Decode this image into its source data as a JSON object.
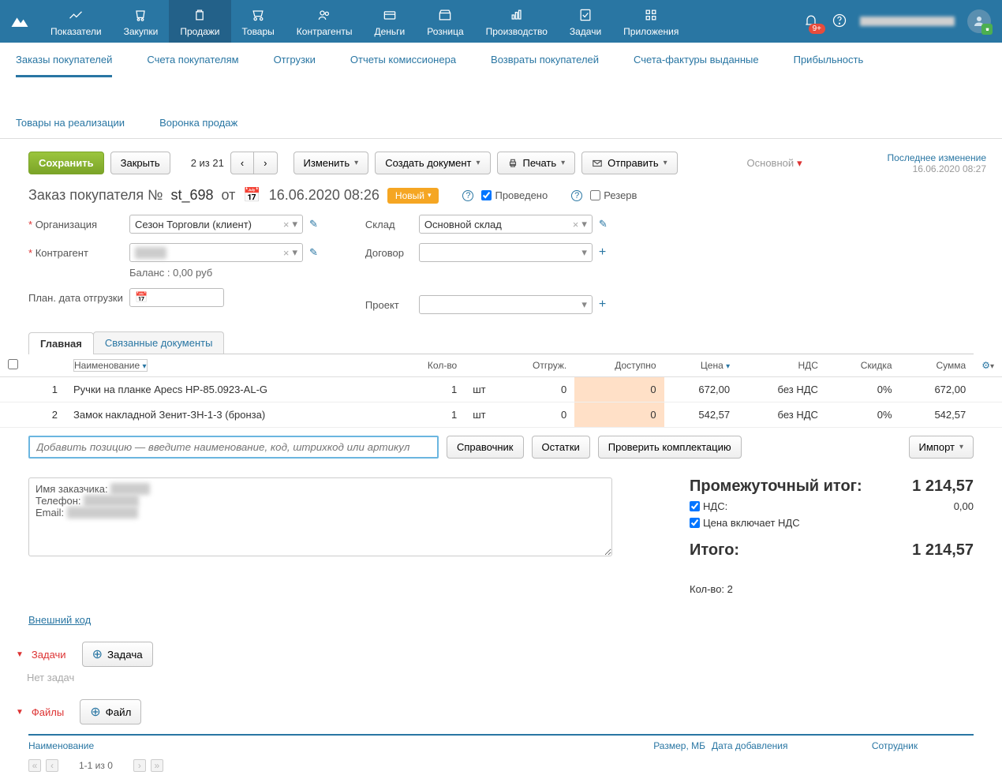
{
  "topnav": {
    "items": [
      {
        "label": "Показатели"
      },
      {
        "label": "Закупки"
      },
      {
        "label": "Продажи"
      },
      {
        "label": "Товары"
      },
      {
        "label": "Контрагенты"
      },
      {
        "label": "Деньги"
      },
      {
        "label": "Розница"
      },
      {
        "label": "Производство"
      },
      {
        "label": "Задачи"
      },
      {
        "label": "Приложения"
      }
    ],
    "notif_badge": "9+"
  },
  "subnav": {
    "items": [
      "Заказы покупателей",
      "Счета покупателям",
      "Отгрузки",
      "Отчеты комиссионера",
      "Возвраты покупателей",
      "Счета-фактуры выданные",
      "Прибыльность",
      "Товары на реализации",
      "Воронка продаж"
    ]
  },
  "toolbar": {
    "save": "Сохранить",
    "close": "Закрыть",
    "pager_text": "2 из 21",
    "edit": "Изменить",
    "create_doc": "Создать документ",
    "print": "Печать",
    "send": "Отправить",
    "type": "Основной",
    "last_change_label": "Последнее изменение",
    "last_change_time": "16.06.2020 08:27"
  },
  "doc": {
    "title_prefix": "Заказ покупателя №",
    "number": "st_698",
    "from": "от",
    "date": "16.06.2020 08:26",
    "status": "Новый",
    "posted_label": "Проведено",
    "reserve_label": "Резерв"
  },
  "form": {
    "org_label": "Организация",
    "org_value": "Сезон Торговли (клиент)",
    "counterparty_label": "Контрагент",
    "counterparty_value": "████",
    "balance": "Баланс : 0,00 руб",
    "plan_date_label": "План. дата отгрузки",
    "warehouse_label": "Склад",
    "warehouse_value": "Основной склад",
    "contract_label": "Договор",
    "project_label": "Проект"
  },
  "tabs": {
    "main": "Главная",
    "related": "Связанные документы"
  },
  "grid": {
    "name_hdr": "Наименование",
    "qty_hdr": "Кол-во",
    "shipped_hdr": "Отгруж.",
    "avail_hdr": "Доступно",
    "price_hdr": "Цена",
    "vat_hdr": "НДС",
    "discount_hdr": "Скидка",
    "sum_hdr": "Сумма",
    "rows": [
      {
        "n": "1",
        "name": "Ручки на планке Apecs HP-85.0923-AL-G",
        "qty": "1",
        "unit": "шт",
        "shipped": "0",
        "avail": "0",
        "price": "672,00",
        "vat": "без НДС",
        "disc": "0%",
        "sum": "672,00"
      },
      {
        "n": "2",
        "name": "Замок накладной Зенит-ЗН-1-3 (бронза)",
        "qty": "1",
        "unit": "шт",
        "shipped": "0",
        "avail": "0",
        "price": "542,57",
        "vat": "без НДС",
        "disc": "0%",
        "sum": "542,57"
      }
    ],
    "add_placeholder": "Добавить позицию — введите наименование, код, штрихкод или артикул",
    "reference": "Справочник",
    "stock": "Остатки",
    "check_kit": "Проверить комплектацию",
    "import": "Импорт"
  },
  "notes": {
    "line1": "Имя заказчика: ",
    "line2": "Телефон: ",
    "line3": "Email: "
  },
  "totals": {
    "subtotal_label": "Промежуточный итог:",
    "subtotal": "1 214,57",
    "vat_label": "НДС:",
    "vat_value": "0,00",
    "price_includes_vat": "Цена включает НДС",
    "total_label": "Итого:",
    "total": "1 214,57",
    "qty_label": "Кол-во: 2"
  },
  "ext_code": "Внешний код",
  "tasks": {
    "header": "Задачи",
    "add": "Задача",
    "empty": "Нет задач"
  },
  "files": {
    "header": "Файлы",
    "add": "Файл",
    "cols": {
      "name": "Наименование",
      "size": "Размер, МБ",
      "date": "Дата добавления",
      "employee": "Сотрудник"
    },
    "pager": "1-1 из 0"
  }
}
